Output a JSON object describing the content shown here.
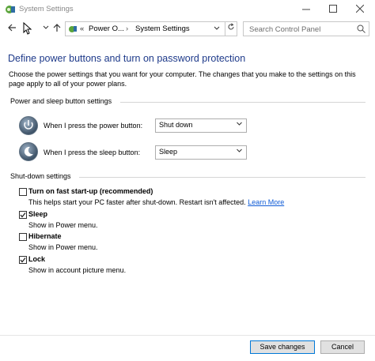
{
  "window": {
    "title": "System Settings"
  },
  "addressbar": {
    "chevrons": "«",
    "crumbs": [
      "Power O...",
      "System Settings"
    ]
  },
  "search": {
    "placeholder": "Search Control Panel"
  },
  "page": {
    "title": "Define power buttons and turn on password protection",
    "description": "Choose the power settings that you want for your computer. The changes that you make to the settings on this page apply to all of your power plans."
  },
  "power_group": {
    "title": "Power and sleep button settings",
    "power_label": "When I press the power button:",
    "power_value": "Shut down",
    "sleep_label": "When I press the sleep button:",
    "sleep_value": "Sleep"
  },
  "shutdown_group": {
    "title": "Shut-down settings",
    "items": [
      {
        "label": "Turn on fast start-up (recommended)",
        "checked": false,
        "desc": "This helps start your PC faster after shut-down. Restart isn't affected.",
        "link": "Learn More"
      },
      {
        "label": "Sleep",
        "checked": true,
        "desc": "Show in Power menu."
      },
      {
        "label": "Hibernate",
        "checked": false,
        "desc": "Show in Power menu."
      },
      {
        "label": "Lock",
        "checked": true,
        "desc": "Show in account picture menu."
      }
    ]
  },
  "footer": {
    "save_label": "Save changes",
    "cancel_label": "Cancel"
  },
  "colors": {
    "title_blue": "#1e3a8a",
    "link_blue": "#0f5bd6",
    "accent": "#0078d7"
  }
}
